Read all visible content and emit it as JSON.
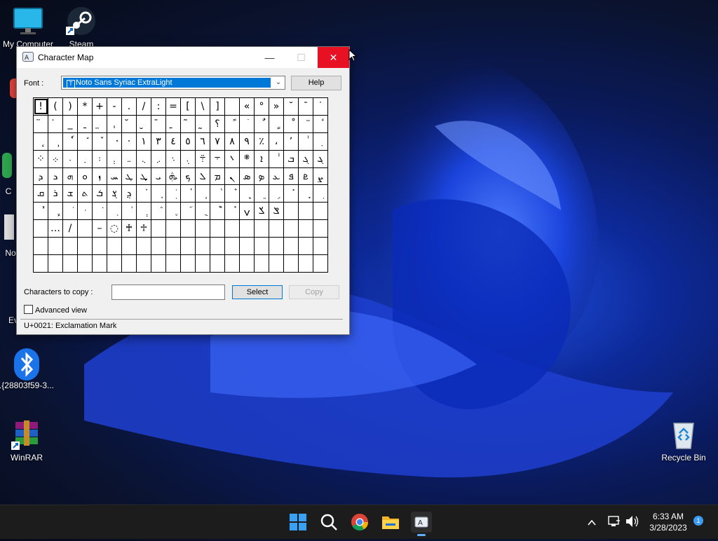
{
  "desktop": {
    "icons": [
      {
        "label": "My Computer",
        "icon": "monitor-icon"
      },
      {
        "label": "Steam",
        "icon": "steam-icon"
      },
      {
        "label": ".{28803f59-3...",
        "icon": "bluetooth-icon"
      },
      {
        "label": "WinRAR",
        "icon": "winrar-icon"
      },
      {
        "label": "Recycle Bin",
        "icon": "recycle-bin-icon"
      }
    ],
    "partial_labels": [
      "C",
      "No",
      "Ev"
    ]
  },
  "window": {
    "title": "Character Map",
    "font_label": "Font :",
    "font_value": "Noto Sans Syriac ExtraLight",
    "help_label": "Help",
    "chars_to_copy_label": "Characters to copy :",
    "chars_to_copy_value": "",
    "select_label": "Select",
    "copy_label": "Copy",
    "advanced_view_label": "Advanced view",
    "advanced_view_checked": false,
    "status_text": "U+0021: Exclamation Mark"
  },
  "grid": {
    "rows": [
      [
        "!",
        "(",
        ")",
        "*",
        "+",
        "-",
        ".",
        "/",
        ":",
        "=",
        "[",
        "\\",
        "]",
        "",
        "«",
        "°",
        "»",
        "˘",
        "¯",
        "˙"
      ],
      [
        "̈",
        "̇",
        "_",
        "ˍ",
        "̤",
        "ˌ",
        "̆",
        "̮",
        "̄",
        "̱",
        "̃",
        "̰",
        "؟",
        "ً",
        "ٙ",
        "ٌ",
        "ٍ",
        "ْ",
        "ٓ",
        "ٔ"
      ],
      [
        "ٕ",
        "ٖ",
        "ٗ",
        "٘",
        "ٚ",
        "ٛ",
        "·",
        "١",
        "٣",
        "٤",
        "٥",
        "٦",
        "٧",
        "٨",
        "٩",
        "٪",
        "،",
        "ʼ",
        "ٰ",
        "ٜ"
      ],
      [
        "⁘",
        "܀",
        "܁",
        "܂",
        "܃",
        "܄",
        "܅",
        "܆",
        "܇",
        "܈",
        "܉",
        "܊",
        "܋",
        "܌",
        "܍",
        "ܐ",
        "ܑ",
        "ܒ",
        "ܓ",
        "ܔ"
      ],
      [
        "ܕ",
        "ܖ",
        "ܗ",
        "ܘ",
        "ܙ",
        "ܚ",
        "ܛ",
        "ܜ",
        "ܝ",
        "ܞ",
        "ܟ",
        "ܠ",
        "ܡ",
        "ܢ",
        "ܣ",
        "ܤ",
        "ܥ",
        "ܦ",
        "ܧ",
        "ܨ"
      ],
      [
        "ܩ",
        "ܪ",
        "ܫ",
        "ܬ",
        "ܭ",
        "ܮ",
        "ܯ",
        "ܰ",
        "ܱ",
        "ܲ",
        "ܳ",
        "ܴ",
        "ܵ",
        "ܶ",
        "ܷ",
        "ܸ",
        "ܹ",
        "ܺ",
        "ܻ",
        "ܼ"
      ],
      [
        "ܽ",
        "ܾ",
        "ܿ",
        "݀",
        "݁",
        "݂",
        "݃",
        "݄",
        "݅",
        "݆",
        "݇",
        "݈",
        "݉",
        "݊",
        "ݍ",
        "ݎ",
        "ݏ",
        "",
        "",
        ""
      ],
      [
        "",
        "…",
        "/",
        "",
        "–",
        "◌",
        "♰",
        "♱",
        "",
        "",
        "",
        "",
        "",
        "",
        "",
        "",
        "",
        "",
        "",
        ""
      ],
      [
        "",
        "",
        "",
        "",
        "",
        "",
        "",
        "",
        "",
        "",
        "",
        "",
        "",
        "",
        "",
        "",
        "",
        "",
        "",
        ""
      ],
      [
        "",
        "",
        "",
        "",
        "",
        "",
        "",
        "",
        "",
        "",
        "",
        "",
        "",
        "",
        "",
        "",
        "",
        "",
        "",
        ""
      ]
    ]
  },
  "taskbar": {
    "items": [
      "start-icon",
      "search-icon",
      "chrome-icon",
      "file-explorer-icon",
      "character-map-icon"
    ],
    "time": "6:33 AM",
    "date": "3/28/2023",
    "notification_count": "1"
  }
}
